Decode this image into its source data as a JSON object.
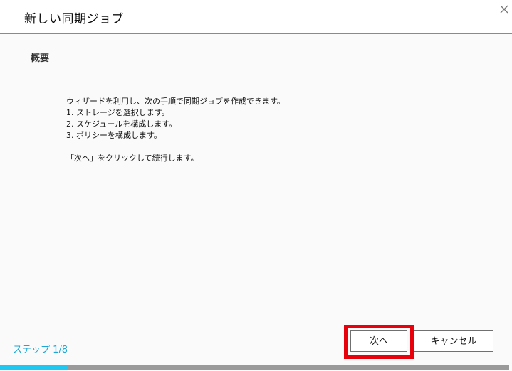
{
  "dialog": {
    "title": "新しい同期ジョブ",
    "close_icon": "close-icon",
    "section_heading": "概要",
    "description_lines": [
      "ウィザードを利用し、次の手順で同期ジョブを作成できます。",
      "1. ストレージを選択します。",
      "2. スケジュールを構成します。",
      "3. ポリシーを構成します。"
    ],
    "instruction": "「次へ」をクリックして続行します。"
  },
  "footer": {
    "step_label": "ステップ 1/8",
    "next_label": "次へ",
    "cancel_label": "キャンセル",
    "progress_fraction": 0.125,
    "highlight_color": "#e8000b",
    "accent_color": "#1ec8f0"
  }
}
